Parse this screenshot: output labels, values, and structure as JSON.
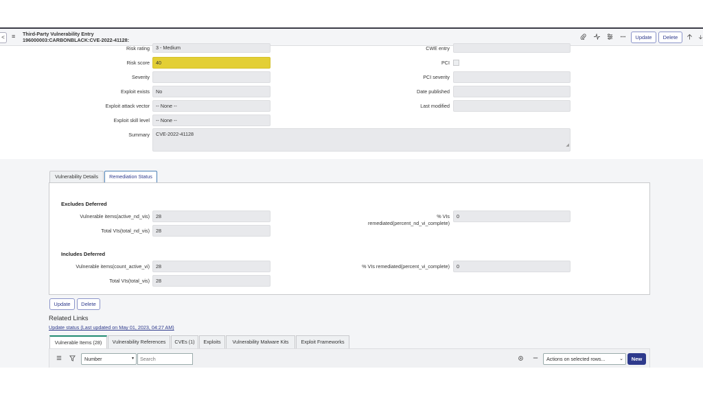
{
  "header": {
    "title_line1": "Third-Party Vulnerability Entry",
    "title_line2": "196000003:CARBONBLACK:CVE-2022-41128:",
    "update_label": "Update",
    "delete_label": "Delete",
    "back_glyph": "<",
    "menu_glyph": "≡",
    "icons": [
      "paperclip-icon",
      "activity-icon",
      "settings-sliders-icon",
      "more-icon",
      "arrow-up-icon",
      "arrow-down-icon"
    ]
  },
  "form": {
    "left": [
      {
        "label": "Risk rating",
        "value": "3 - Medium"
      },
      {
        "label": "Risk score",
        "value": "40"
      },
      {
        "label": "Severity",
        "value": ""
      },
      {
        "label": "Exploit exists",
        "value": "No"
      },
      {
        "label": "Exploit attack vector",
        "value": "-- None --"
      },
      {
        "label": "Exploit skill level",
        "value": "-- None --"
      },
      {
        "label": "Summary",
        "value": "CVE-2022-41128"
      }
    ],
    "right": [
      {
        "label": "CWE entry",
        "value": ""
      },
      {
        "label": "PCI",
        "value": ""
      },
      {
        "label": "PCI severity",
        "value": ""
      },
      {
        "label": "Date published",
        "value": ""
      },
      {
        "label": "Last modified",
        "value": ""
      }
    ]
  },
  "tabs": [
    "Vulnerability Details",
    "Remediation Status"
  ],
  "remediation": {
    "excludes_title": "Excludes Deferred",
    "includes_title": "Includes Deferred",
    "excludes": {
      "vuln_items_label": "Vulnerable items(active_nd_vis)",
      "vuln_items_value": "28",
      "total_label": "Total VIs(total_nd_vis)",
      "total_value": "28",
      "pct_label_line1": "% VIs",
      "pct_label_line2": "remediated(percent_nd_vi_complete)",
      "pct_value": "0"
    },
    "includes": {
      "vuln_items_label": "Vulnerable items(count_active_vi)",
      "vuln_items_value": "28",
      "total_label": "Total VIs(total_vis)",
      "total_value": "28",
      "pct_label": "% VIs remediated(percent_vi_complete)",
      "pct_value": "0"
    }
  },
  "footer_buttons": {
    "update": "Update",
    "delete": "Delete"
  },
  "related": {
    "title": "Related Links",
    "link": "Update status (Last updated on May 01, 2023, 04:27 AM)"
  },
  "related_tabs": [
    "Vulnerable Items (28)",
    "Vulnerability References",
    "CVEs (1)",
    "Exploits",
    "Vulnerability Malware Kits",
    "Exploit Frameworks"
  ],
  "list": {
    "field_select": "Number",
    "search_placeholder": "Search",
    "actions_select": "Actions on selected rows...",
    "new_label": "New"
  },
  "colors": {
    "accent": "#2e3a8c",
    "highlight": "#e3cf35",
    "active_tab_border": "#1f8a70"
  }
}
